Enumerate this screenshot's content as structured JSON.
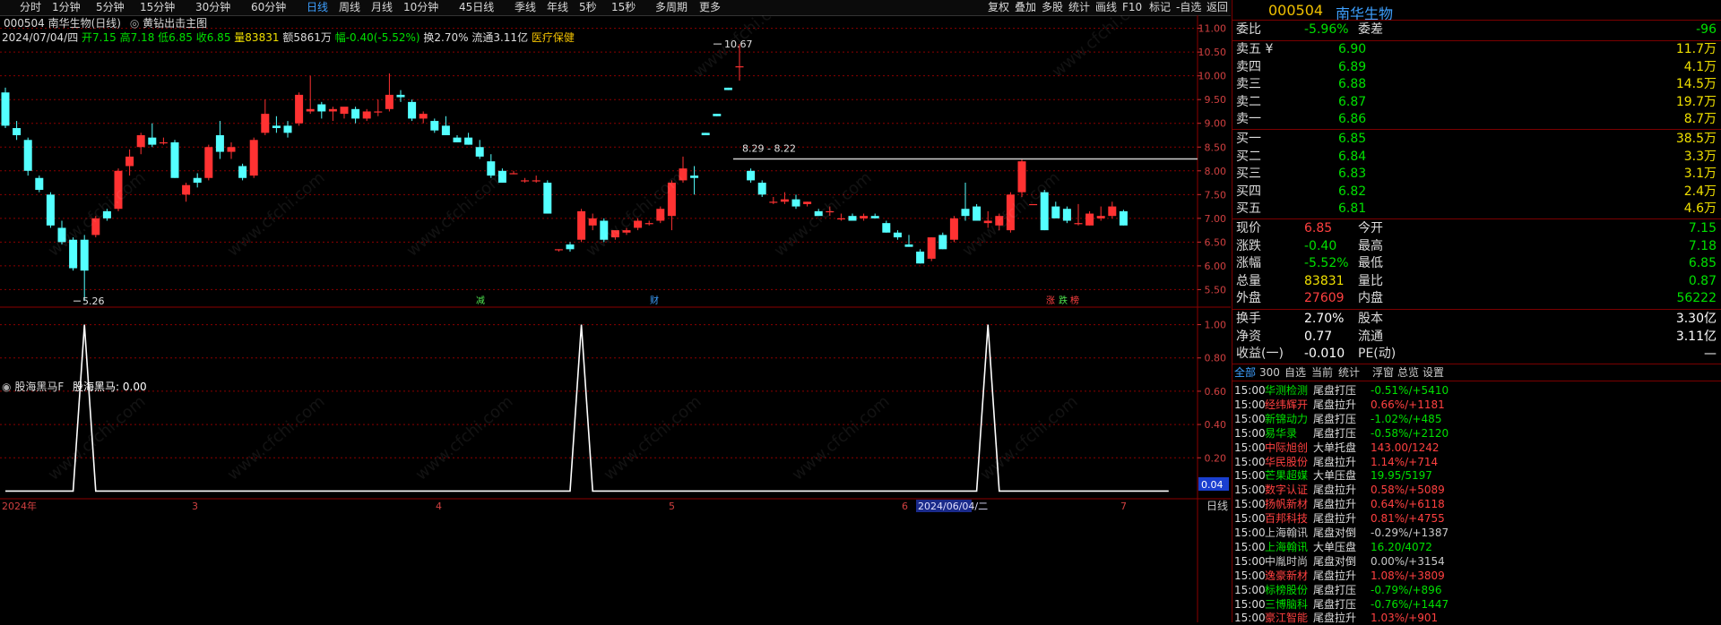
{
  "toolbar": {
    "periods": [
      "分时",
      "1分钟",
      "5分钟",
      "15分钟",
      "30分钟",
      "60分钟",
      "日线",
      "周线",
      "月线",
      "10分钟",
      "45日线",
      "季线",
      "年线",
      "5秒",
      "15秒",
      "多周期",
      "更多"
    ],
    "active_period": "日线",
    "right_buttons": [
      "复权",
      "叠加",
      "多股",
      "统计",
      "画线",
      "F10",
      "标记",
      "-自选",
      "返回"
    ]
  },
  "stock": {
    "title": "000504 南华生物(日线)",
    "indicator": "黄钻出击主图",
    "date": "2024/07/04/四",
    "open": "开7.15",
    "high": "高7.18",
    "low": "低6.85",
    "close": "收6.85",
    "volume": "量83831",
    "amount": "额5861万",
    "change": "幅-0.40(-5.52%)",
    "turnover": "换2.70%",
    "float": "流通3.11亿",
    "industry": "医疗保健"
  },
  "annotations": {
    "high_label": "10.67",
    "low_label": "5.26",
    "range_label": "8.29 - 8.22",
    "markers": [
      "减",
      "财",
      "涨",
      "跌",
      "榜"
    ]
  },
  "lower_panel": {
    "title": "股海黑马F",
    "series": "股海黑马: 0.00",
    "current_value": "0.04"
  },
  "chart_data": [
    {
      "type": "candlestick",
      "title": "000504 南华生物(日线)",
      "y_ticks": [
        "11.00",
        "10.50",
        "10.00",
        "9.50",
        "9.00",
        "8.50",
        "8.00",
        "7.50",
        "7.00",
        "6.50",
        "6.00",
        "5.50"
      ],
      "ylim": [
        5.15,
        11.2
      ],
      "x_labels": [
        "2024年",
        "3",
        "4",
        "5",
        "6",
        "2024/06/04/二",
        "7"
      ],
      "guide_line": 8.25,
      "candles": [
        [
          9.65,
          9.75,
          8.9,
          8.95
        ],
        [
          8.9,
          9.05,
          8.65,
          8.75
        ],
        [
          8.65,
          8.7,
          7.9,
          8.0
        ],
        [
          7.85,
          7.9,
          7.55,
          7.6
        ],
        [
          7.5,
          7.55,
          6.8,
          6.85
        ],
        [
          6.8,
          6.95,
          6.45,
          6.5
        ],
        [
          6.55,
          6.6,
          5.9,
          5.95
        ],
        [
          6.55,
          6.65,
          5.26,
          5.9
        ],
        [
          6.65,
          7.05,
          6.6,
          7.0
        ],
        [
          7.15,
          7.2,
          6.95,
          7.0
        ],
        [
          7.2,
          8.05,
          7.15,
          8.0
        ],
        [
          8.1,
          8.45,
          7.9,
          8.3
        ],
        [
          8.5,
          8.8,
          8.35,
          8.75
        ],
        [
          8.7,
          9.0,
          8.5,
          8.55
        ],
        [
          8.6,
          8.7,
          8.55,
          8.6
        ],
        [
          8.6,
          8.65,
          7.85,
          7.85
        ],
        [
          7.5,
          7.75,
          7.35,
          7.7
        ],
        [
          7.85,
          7.95,
          7.65,
          7.75
        ],
        [
          7.85,
          8.55,
          7.8,
          8.5
        ],
        [
          8.75,
          9.05,
          8.25,
          8.4
        ],
        [
          8.4,
          8.6,
          8.25,
          8.5
        ],
        [
          8.1,
          8.15,
          7.8,
          7.85
        ],
        [
          7.9,
          8.7,
          7.85,
          8.65
        ],
        [
          8.8,
          9.5,
          8.75,
          9.2
        ],
        [
          8.95,
          9.15,
          8.8,
          8.9
        ],
        [
          8.95,
          9.05,
          8.7,
          8.8
        ],
        [
          9.0,
          9.65,
          8.95,
          9.6
        ],
        [
          9.25,
          10.0,
          9.2,
          9.3
        ],
        [
          9.4,
          9.45,
          9.1,
          9.25
        ],
        [
          9.25,
          9.35,
          9.05,
          9.3
        ],
        [
          9.2,
          9.3,
          9.1,
          9.35
        ],
        [
          9.3,
          9.35,
          9.0,
          9.1
        ],
        [
          9.1,
          9.3,
          9.05,
          9.25
        ],
        [
          9.25,
          9.5,
          9.15,
          9.25
        ],
        [
          9.3,
          10.05,
          9.25,
          9.6
        ],
        [
          9.6,
          9.7,
          9.45,
          9.55
        ],
        [
          9.45,
          9.5,
          9.05,
          9.1
        ],
        [
          9.1,
          9.25,
          9.0,
          9.2
        ],
        [
          9.05,
          9.1,
          8.8,
          8.85
        ],
        [
          8.95,
          9.15,
          8.8,
          8.75
        ],
        [
          8.7,
          8.75,
          8.6,
          8.6
        ],
        [
          8.7,
          8.8,
          8.55,
          8.55
        ],
        [
          8.5,
          8.65,
          8.25,
          8.3
        ],
        [
          8.2,
          8.35,
          7.85,
          7.9
        ],
        [
          8.0,
          8.05,
          7.75,
          7.75
        ],
        [
          7.95,
          8.0,
          7.95,
          7.95
        ],
        [
          7.8,
          7.85,
          7.75,
          7.8
        ],
        [
          7.8,
          7.9,
          7.75,
          7.8
        ],
        [
          7.75,
          7.8,
          7.1,
          7.1
        ],
        [
          6.35,
          6.35,
          6.3,
          6.35
        ],
        [
          6.45,
          6.5,
          6.3,
          6.35
        ],
        [
          6.55,
          7.2,
          6.5,
          7.15
        ],
        [
          6.85,
          7.1,
          6.75,
          7.0
        ],
        [
          6.95,
          7.0,
          6.5,
          6.55
        ],
        [
          6.6,
          6.75,
          6.55,
          6.75
        ],
        [
          6.7,
          6.8,
          6.65,
          6.75
        ],
        [
          6.8,
          7.0,
          6.75,
          6.95
        ],
        [
          6.9,
          6.95,
          6.85,
          6.9
        ],
        [
          6.95,
          7.25,
          6.9,
          7.2
        ],
        [
          7.05,
          7.8,
          6.75,
          7.75
        ],
        [
          7.8,
          8.3,
          7.75,
          8.05
        ],
        [
          7.9,
          8.1,
          7.5,
          7.85
        ],
        [
          8.8,
          8.8,
          8.75,
          8.75
        ],
        [
          9.2,
          9.2,
          9.15,
          9.15
        ],
        [
          9.75,
          9.75,
          9.7,
          9.7
        ],
        [
          10.2,
          10.67,
          9.9,
          10.2
        ],
        [
          8.0,
          8.05,
          7.75,
          7.8
        ],
        [
          7.75,
          7.8,
          7.45,
          7.5
        ],
        [
          7.35,
          7.45,
          7.3,
          7.35
        ],
        [
          7.35,
          7.55,
          7.3,
          7.4
        ],
        [
          7.4,
          7.5,
          7.2,
          7.25
        ],
        [
          7.3,
          7.35,
          7.25,
          7.35
        ],
        [
          7.15,
          7.2,
          7.05,
          7.05
        ],
        [
          7.15,
          7.25,
          7.05,
          7.15
        ],
        [
          7.0,
          7.1,
          6.95,
          7.0
        ],
        [
          7.05,
          7.1,
          6.95,
          6.95
        ],
        [
          7.0,
          7.1,
          6.95,
          7.05
        ],
        [
          7.05,
          7.1,
          7.0,
          7.0
        ],
        [
          6.9,
          6.95,
          6.7,
          6.7
        ],
        [
          6.7,
          6.75,
          6.55,
          6.6
        ],
        [
          6.45,
          6.65,
          6.4,
          6.4
        ],
        [
          6.3,
          6.35,
          6.05,
          6.05
        ],
        [
          6.15,
          6.6,
          6.1,
          6.6
        ],
        [
          6.65,
          6.7,
          6.35,
          6.35
        ],
        [
          6.55,
          7.05,
          6.5,
          7.0
        ],
        [
          7.2,
          7.75,
          6.95,
          7.05
        ],
        [
          7.25,
          7.3,
          6.95,
          6.95
        ],
        [
          6.9,
          7.15,
          6.8,
          6.95
        ],
        [
          6.85,
          7.1,
          6.75,
          7.05
        ],
        [
          6.75,
          7.55,
          6.7,
          7.5
        ],
        [
          7.55,
          8.25,
          7.45,
          8.2
        ],
        [
          7.3,
          7.3,
          7.3,
          7.3
        ],
        [
          7.55,
          7.6,
          6.75,
          6.75
        ],
        [
          7.25,
          7.35,
          7.0,
          7.0
        ],
        [
          7.2,
          7.25,
          6.9,
          6.95
        ],
        [
          6.9,
          7.3,
          6.85,
          6.9
        ],
        [
          6.85,
          7.15,
          6.85,
          7.1
        ],
        [
          7.0,
          7.25,
          6.95,
          7.05
        ],
        [
          7.05,
          7.35,
          7.0,
          7.25
        ],
        [
          7.15,
          7.18,
          6.85,
          6.85
        ]
      ]
    },
    {
      "type": "line",
      "title": "股海黑马F",
      "y_ticks": [
        "1.00",
        "0.80",
        "0.60",
        "0.40",
        "0.20"
      ],
      "ylim": [
        -0.03,
        1.03
      ],
      "series": [
        {
          "name": "股海黑马",
          "values": [
            0,
            0,
            0,
            0,
            0,
            0,
            0,
            1,
            0,
            0,
            0,
            0,
            0,
            0,
            0,
            0,
            0,
            0,
            0,
            0,
            0,
            0,
            0,
            0,
            0,
            0,
            0,
            0,
            0,
            0,
            0,
            0,
            0,
            0,
            0,
            0,
            0,
            0,
            0,
            0,
            0,
            0,
            0,
            0,
            0,
            0,
            0,
            0,
            0,
            0,
            0,
            1,
            0,
            0,
            0,
            0,
            0,
            0,
            0,
            0,
            0,
            0,
            0,
            0,
            0,
            0,
            0,
            0,
            0,
            0,
            0,
            0,
            0,
            0,
            0,
            0,
            0,
            0,
            0,
            0,
            0,
            0,
            0,
            0,
            0,
            0,
            0,
            1,
            0,
            0,
            0,
            0,
            0,
            0,
            0,
            0,
            0,
            0,
            0,
            0,
            0,
            0,
            0,
            0
          ]
        }
      ]
    }
  ],
  "quote": {
    "code": "000504",
    "name": "南华生物",
    "webi_label": "委比",
    "webi": "-5.96%",
    "weicha_label": "委差",
    "weicha": "-96",
    "asks": [
      {
        "label": "卖五 ¥",
        "price": "6.90",
        "vol": "11.7万"
      },
      {
        "label": "卖四",
        "price": "6.89",
        "vol": "4.1万"
      },
      {
        "label": "卖三",
        "price": "6.88",
        "vol": "14.5万"
      },
      {
        "label": "卖二",
        "price": "6.87",
        "vol": "19.7万"
      },
      {
        "label": "卖一",
        "price": "6.86",
        "vol": "8.7万"
      }
    ],
    "bids": [
      {
        "label": "买一",
        "price": "6.85",
        "vol": "38.5万"
      },
      {
        "label": "买二",
        "price": "6.84",
        "vol": "3.3万"
      },
      {
        "label": "买三",
        "price": "6.83",
        "vol": "3.1万"
      },
      {
        "label": "买四",
        "price": "6.82",
        "vol": "2.4万"
      },
      {
        "label": "买五",
        "price": "6.81",
        "vol": "4.6万"
      }
    ],
    "stats": [
      {
        "l1": "现价",
        "v1": "6.85",
        "c1": "#ff4040",
        "l2": "今开",
        "v2": "7.15",
        "c2": "#00e000"
      },
      {
        "l1": "涨跌",
        "v1": "-0.40",
        "c1": "#00e000",
        "l2": "最高",
        "v2": "7.18",
        "c2": "#00e000"
      },
      {
        "l1": "涨幅",
        "v1": "-5.52%",
        "c1": "#00e000",
        "l2": "最低",
        "v2": "6.85",
        "c2": "#00e000"
      },
      {
        "l1": "总量",
        "v1": "83831",
        "c1": "#f0e000",
        "l2": "量比",
        "v2": "0.87",
        "c2": "#00e000"
      },
      {
        "l1": "外盘",
        "v1": "27609",
        "c1": "#ff4040",
        "l2": "内盘",
        "v2": "56222",
        "c2": "#00e000"
      }
    ],
    "fin": [
      {
        "l1": "换手",
        "v1": "2.70%",
        "l2": "股本",
        "v2": "3.30亿"
      },
      {
        "l1": "净资",
        "v1": "0.77",
        "l2": "流通",
        "v2": "3.11亿"
      },
      {
        "l1": "收益(一)",
        "v1": "-0.010",
        "l2": "PE(动)",
        "v2": "—"
      }
    ]
  },
  "feed": {
    "tabs": [
      "全部",
      "300",
      "自选",
      "当前",
      "统计",
      "浮窗",
      "总览",
      "设置"
    ],
    "rows": [
      {
        "time": "15:00",
        "name": "华测检测",
        "type": "尾盘打压",
        "val": "-0.51%/+5410",
        "c": "#00e000"
      },
      {
        "time": "15:00",
        "name": "经纬辉开",
        "type": "尾盘拉升",
        "val": "0.66%/+1181",
        "c": "#ff4040"
      },
      {
        "time": "15:00",
        "name": "新锦动力",
        "type": "尾盘打压",
        "val": "-1.02%/+485",
        "c": "#00e000"
      },
      {
        "time": "15:00",
        "name": "易华录",
        "type": "尾盘打压",
        "val": "-0.58%/+2120",
        "c": "#00e000"
      },
      {
        "time": "15:00",
        "name": "中际旭创",
        "type": "大单托盘",
        "val": "143.00/1242",
        "c": "#ff4040"
      },
      {
        "time": "15:00",
        "name": "华民股份",
        "type": "尾盘拉升",
        "val": "1.14%/+714",
        "c": "#ff4040"
      },
      {
        "time": "15:00",
        "name": "芒果超媒",
        "type": "大单压盘",
        "val": "19.95/5197",
        "c": "#00e000"
      },
      {
        "time": "15:00",
        "name": "数字认证",
        "type": "尾盘拉升",
        "val": "0.58%/+5089",
        "c": "#ff4040"
      },
      {
        "time": "15:00",
        "name": "扬帆新材",
        "type": "尾盘拉升",
        "val": "0.64%/+6118",
        "c": "#ff4040"
      },
      {
        "time": "15:00",
        "name": "百邦科技",
        "type": "尾盘拉升",
        "val": "0.81%/+4755",
        "c": "#ff4040"
      },
      {
        "time": "15:00",
        "name": "上海翰讯",
        "type": "尾盘对倒",
        "val": "-0.29%/+1387",
        "c": "#c8c8c8"
      },
      {
        "time": "15:00",
        "name": "上海翰讯",
        "type": "大单压盘",
        "val": "16.20/4072",
        "c": "#00e000"
      },
      {
        "time": "15:00",
        "name": "中胤时尚",
        "type": "尾盘对倒",
        "val": "0.00%/+3154",
        "c": "#c8c8c8"
      },
      {
        "time": "15:00",
        "name": "逸豪新材",
        "type": "尾盘拉升",
        "val": "1.08%/+3809",
        "c": "#ff4040"
      },
      {
        "time": "15:00",
        "name": "标榜股份",
        "type": "尾盘打压",
        "val": "-0.79%/+896",
        "c": "#00e000"
      },
      {
        "time": "15:00",
        "name": "三博脑科",
        "type": "尾盘打压",
        "val": "-0.76%/+1447",
        "c": "#00e000"
      },
      {
        "time": "15:00",
        "name": "豪江智能",
        "type": "尾盘拉升",
        "val": "1.03%/+901",
        "c": "#ff4040"
      }
    ]
  },
  "bottom_label": "日线",
  "watermark": "www.cfchi.com",
  "colors": {
    "up": "#ff3232",
    "down": "#54ffff",
    "grid": "#8b0000",
    "accent": "#3ea0ff",
    "gold": "#f0c000"
  }
}
